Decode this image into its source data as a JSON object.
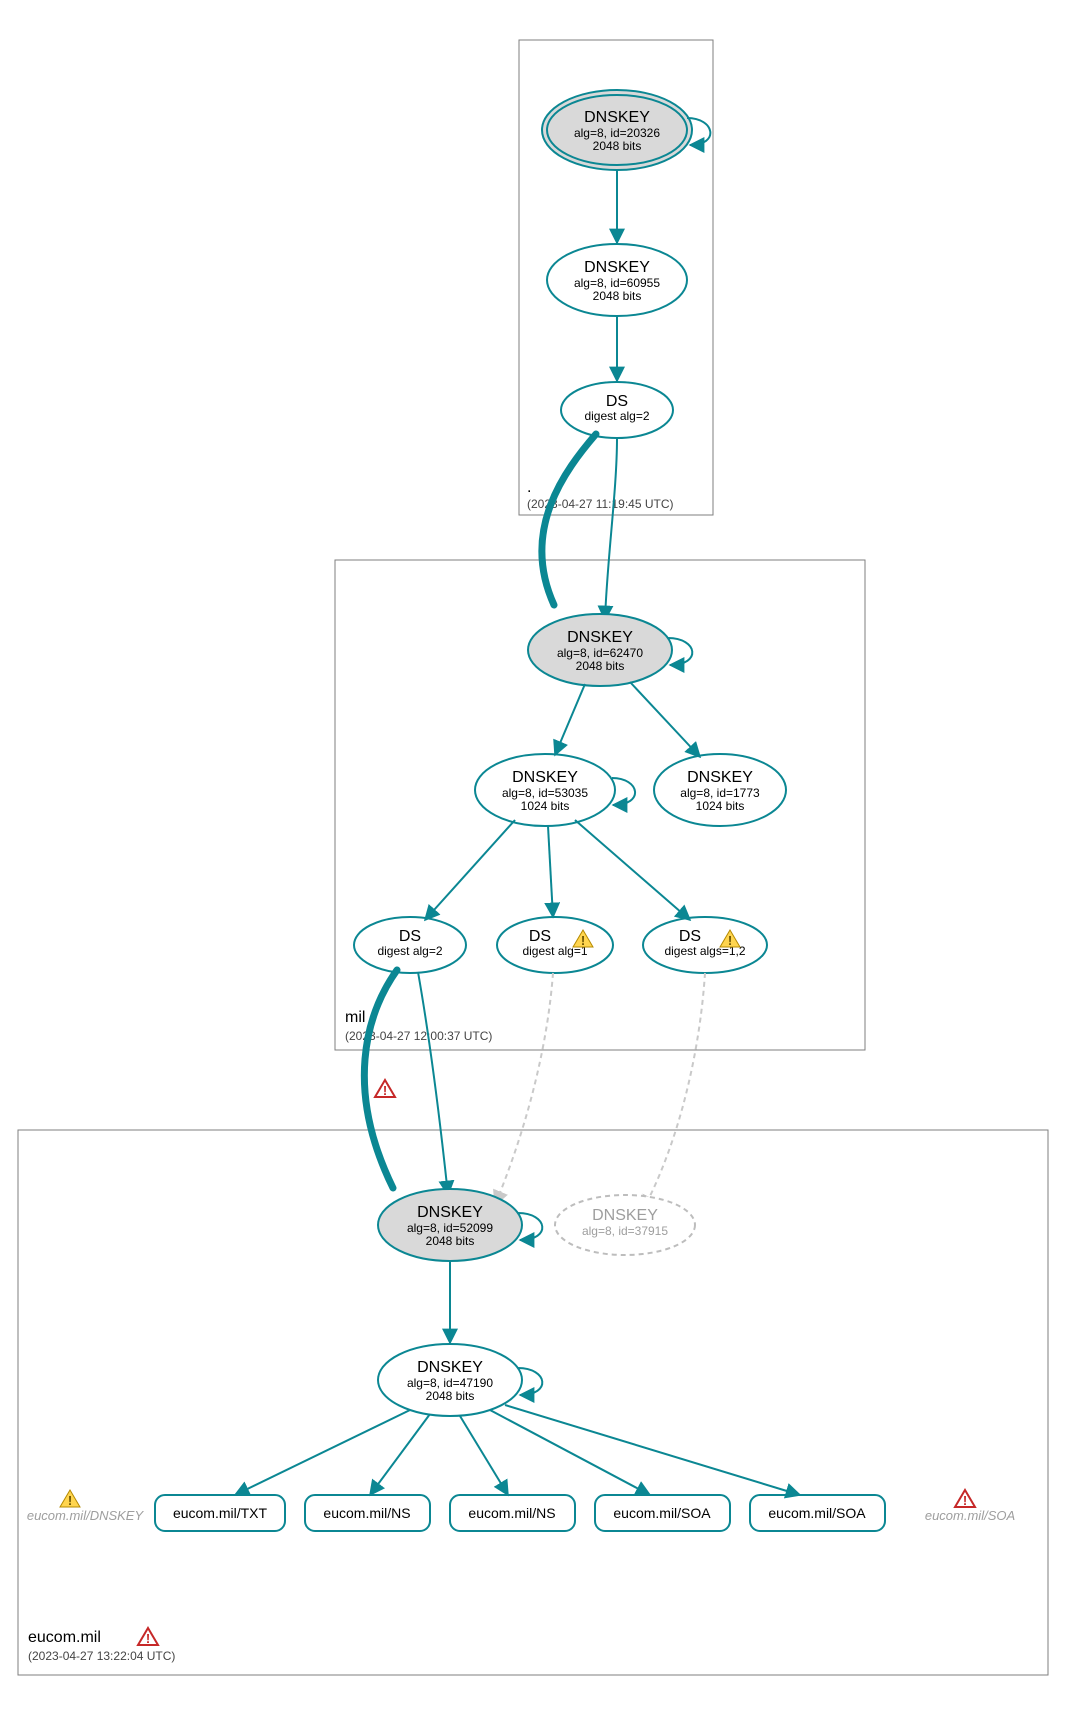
{
  "zones": {
    "root": {
      "label": ".",
      "timestamp": "(2023-04-27 11:19:45 UTC)"
    },
    "mil": {
      "label": "mil",
      "timestamp": "(2023-04-27 12:00:37 UTC)"
    },
    "eucom": {
      "label": "eucom.mil",
      "timestamp": "(2023-04-27 13:22:04 UTC)"
    }
  },
  "nodes": {
    "root_ksk": {
      "title": "DNSKEY",
      "l2": "alg=8, id=20326",
      "l3": "2048 bits"
    },
    "root_zsk": {
      "title": "DNSKEY",
      "l2": "alg=8, id=60955",
      "l3": "2048 bits"
    },
    "root_ds": {
      "title": "DS",
      "l2": "digest alg=2"
    },
    "mil_ksk": {
      "title": "DNSKEY",
      "l2": "alg=8, id=62470",
      "l3": "2048 bits"
    },
    "mil_zsk1": {
      "title": "DNSKEY",
      "l2": "alg=8, id=53035",
      "l3": "1024 bits"
    },
    "mil_zsk2": {
      "title": "DNSKEY",
      "l2": "alg=8, id=1773",
      "l3": "1024 bits"
    },
    "mil_ds1": {
      "title": "DS",
      "l2": "digest alg=2"
    },
    "mil_ds2": {
      "title": "DS",
      "l2": "digest alg=1"
    },
    "mil_ds3": {
      "title": "DS",
      "l2": "digest algs=1,2"
    },
    "eu_ksk": {
      "title": "DNSKEY",
      "l2": "alg=8, id=52099",
      "l3": "2048 bits"
    },
    "eu_ghost": {
      "title": "DNSKEY",
      "l2": "alg=8, id=37915"
    },
    "eu_zsk": {
      "title": "DNSKEY",
      "l2": "alg=8, id=47190",
      "l3": "2048 bits"
    }
  },
  "rrsets": {
    "txt": "eucom.mil/TXT",
    "ns1": "eucom.mil/NS",
    "ns2": "eucom.mil/NS",
    "soa1": "eucom.mil/SOA",
    "soa2": "eucom.mil/SOA",
    "ghost_dnskey": "eucom.mil/DNSKEY",
    "ghost_soa": "eucom.mil/SOA"
  }
}
